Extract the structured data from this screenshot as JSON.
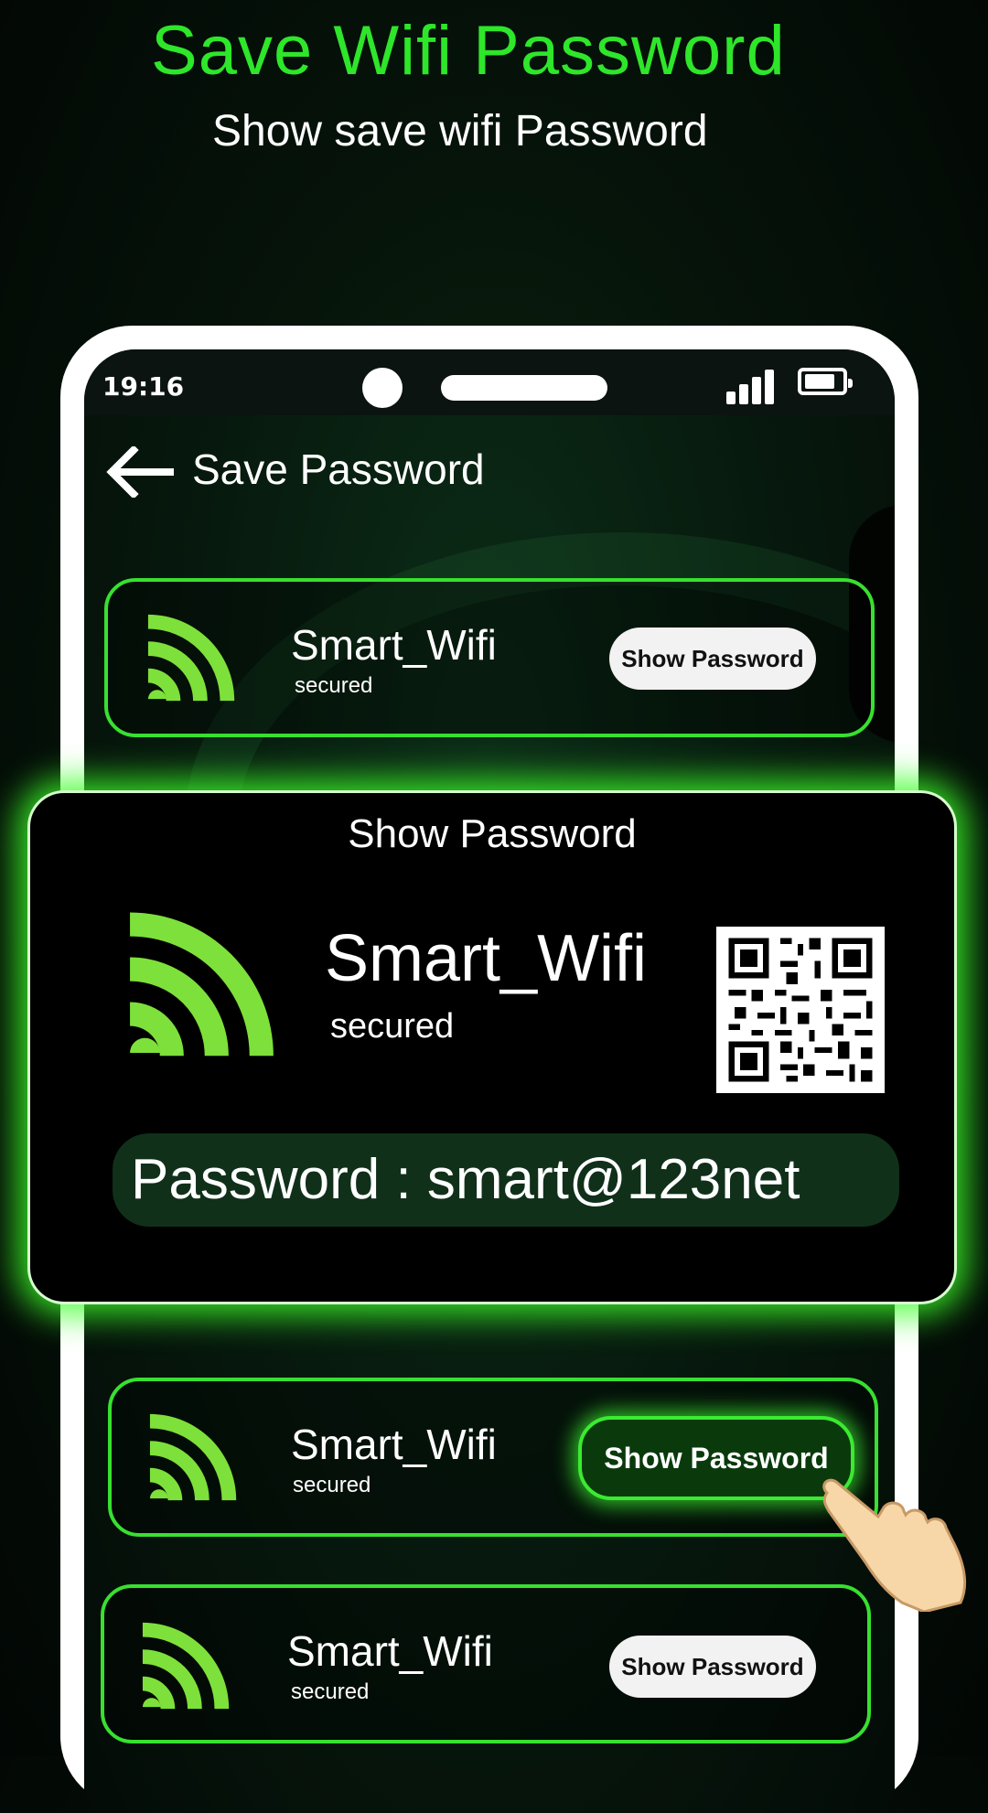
{
  "banner": {
    "headline": "Save Wifi Password",
    "subheadline": "Show save wifi Password"
  },
  "status_bar": {
    "time": "19:16"
  },
  "screen": {
    "title": "Save Password"
  },
  "networks": [
    {
      "name": "Smart_Wifi",
      "status": "secured",
      "button": "Show Password"
    },
    {
      "name": "Smart_Wifi",
      "status": "secured",
      "button": "Show Password"
    },
    {
      "name": "Smart_Wifi",
      "status": "secured",
      "button": "Show Password"
    }
  ],
  "popup": {
    "title": "Show Password",
    "name": "Smart_Wifi",
    "status": "secured",
    "password_text": "Password : smart@123net"
  },
  "icons": [
    "back-arrow-icon",
    "wifi-icon",
    "signal-icon",
    "battery-icon",
    "qr-code-icon",
    "hand-pointer-icon"
  ],
  "colors": {
    "accent_green": "#38e030",
    "headline_green": "#2ee62a",
    "button_light": "#f2f2f2",
    "active_button": "#0a3a0c"
  }
}
